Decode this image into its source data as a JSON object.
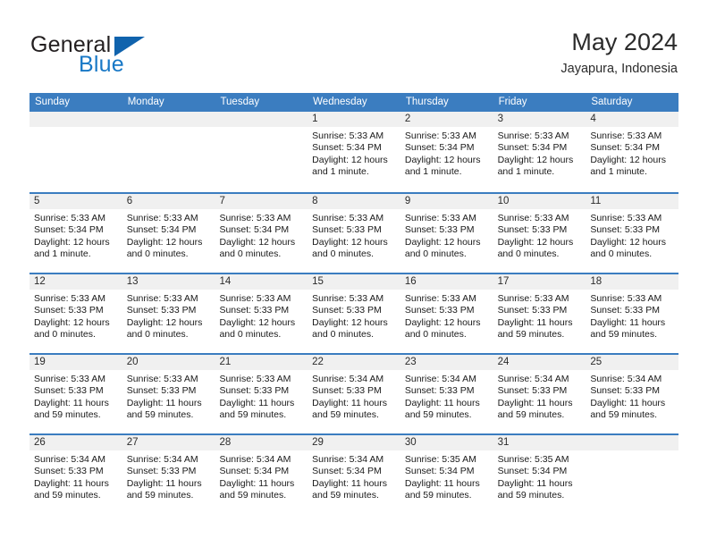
{
  "brand": {
    "name_top": "General",
    "name_bottom": "Blue",
    "accent_color": "#1878c6",
    "triangle_color": "#1063ad"
  },
  "header": {
    "title": "May 2024",
    "subtitle": "Jayapura, Indonesia"
  },
  "theme": {
    "header_row_bg": "#3b7dc0",
    "day_band_bg": "#f0f0f0",
    "week_separator": "#3b7dc0"
  },
  "weekdays": [
    "Sunday",
    "Monday",
    "Tuesday",
    "Wednesday",
    "Thursday",
    "Friday",
    "Saturday"
  ],
  "weeks": [
    [
      {
        "day": "",
        "empty": true
      },
      {
        "day": "",
        "empty": true
      },
      {
        "day": "",
        "empty": true
      },
      {
        "day": "1",
        "sunrise": "Sunrise: 5:33 AM",
        "sunset": "Sunset: 5:34 PM",
        "daylight_1": "Daylight: 12 hours",
        "daylight_2": "and 1 minute."
      },
      {
        "day": "2",
        "sunrise": "Sunrise: 5:33 AM",
        "sunset": "Sunset: 5:34 PM",
        "daylight_1": "Daylight: 12 hours",
        "daylight_2": "and 1 minute."
      },
      {
        "day": "3",
        "sunrise": "Sunrise: 5:33 AM",
        "sunset": "Sunset: 5:34 PM",
        "daylight_1": "Daylight: 12 hours",
        "daylight_2": "and 1 minute."
      },
      {
        "day": "4",
        "sunrise": "Sunrise: 5:33 AM",
        "sunset": "Sunset: 5:34 PM",
        "daylight_1": "Daylight: 12 hours",
        "daylight_2": "and 1 minute."
      }
    ],
    [
      {
        "day": "5",
        "sunrise": "Sunrise: 5:33 AM",
        "sunset": "Sunset: 5:34 PM",
        "daylight_1": "Daylight: 12 hours",
        "daylight_2": "and 1 minute."
      },
      {
        "day": "6",
        "sunrise": "Sunrise: 5:33 AM",
        "sunset": "Sunset: 5:34 PM",
        "daylight_1": "Daylight: 12 hours",
        "daylight_2": "and 0 minutes."
      },
      {
        "day": "7",
        "sunrise": "Sunrise: 5:33 AM",
        "sunset": "Sunset: 5:34 PM",
        "daylight_1": "Daylight: 12 hours",
        "daylight_2": "and 0 minutes."
      },
      {
        "day": "8",
        "sunrise": "Sunrise: 5:33 AM",
        "sunset": "Sunset: 5:33 PM",
        "daylight_1": "Daylight: 12 hours",
        "daylight_2": "and 0 minutes."
      },
      {
        "day": "9",
        "sunrise": "Sunrise: 5:33 AM",
        "sunset": "Sunset: 5:33 PM",
        "daylight_1": "Daylight: 12 hours",
        "daylight_2": "and 0 minutes."
      },
      {
        "day": "10",
        "sunrise": "Sunrise: 5:33 AM",
        "sunset": "Sunset: 5:33 PM",
        "daylight_1": "Daylight: 12 hours",
        "daylight_2": "and 0 minutes."
      },
      {
        "day": "11",
        "sunrise": "Sunrise: 5:33 AM",
        "sunset": "Sunset: 5:33 PM",
        "daylight_1": "Daylight: 12 hours",
        "daylight_2": "and 0 minutes."
      }
    ],
    [
      {
        "day": "12",
        "sunrise": "Sunrise: 5:33 AM",
        "sunset": "Sunset: 5:33 PM",
        "daylight_1": "Daylight: 12 hours",
        "daylight_2": "and 0 minutes."
      },
      {
        "day": "13",
        "sunrise": "Sunrise: 5:33 AM",
        "sunset": "Sunset: 5:33 PM",
        "daylight_1": "Daylight: 12 hours",
        "daylight_2": "and 0 minutes."
      },
      {
        "day": "14",
        "sunrise": "Sunrise: 5:33 AM",
        "sunset": "Sunset: 5:33 PM",
        "daylight_1": "Daylight: 12 hours",
        "daylight_2": "and 0 minutes."
      },
      {
        "day": "15",
        "sunrise": "Sunrise: 5:33 AM",
        "sunset": "Sunset: 5:33 PM",
        "daylight_1": "Daylight: 12 hours",
        "daylight_2": "and 0 minutes."
      },
      {
        "day": "16",
        "sunrise": "Sunrise: 5:33 AM",
        "sunset": "Sunset: 5:33 PM",
        "daylight_1": "Daylight: 12 hours",
        "daylight_2": "and 0 minutes."
      },
      {
        "day": "17",
        "sunrise": "Sunrise: 5:33 AM",
        "sunset": "Sunset: 5:33 PM",
        "daylight_1": "Daylight: 11 hours",
        "daylight_2": "and 59 minutes."
      },
      {
        "day": "18",
        "sunrise": "Sunrise: 5:33 AM",
        "sunset": "Sunset: 5:33 PM",
        "daylight_1": "Daylight: 11 hours",
        "daylight_2": "and 59 minutes."
      }
    ],
    [
      {
        "day": "19",
        "sunrise": "Sunrise: 5:33 AM",
        "sunset": "Sunset: 5:33 PM",
        "daylight_1": "Daylight: 11 hours",
        "daylight_2": "and 59 minutes."
      },
      {
        "day": "20",
        "sunrise": "Sunrise: 5:33 AM",
        "sunset": "Sunset: 5:33 PM",
        "daylight_1": "Daylight: 11 hours",
        "daylight_2": "and 59 minutes."
      },
      {
        "day": "21",
        "sunrise": "Sunrise: 5:33 AM",
        "sunset": "Sunset: 5:33 PM",
        "daylight_1": "Daylight: 11 hours",
        "daylight_2": "and 59 minutes."
      },
      {
        "day": "22",
        "sunrise": "Sunrise: 5:34 AM",
        "sunset": "Sunset: 5:33 PM",
        "daylight_1": "Daylight: 11 hours",
        "daylight_2": "and 59 minutes."
      },
      {
        "day": "23",
        "sunrise": "Sunrise: 5:34 AM",
        "sunset": "Sunset: 5:33 PM",
        "daylight_1": "Daylight: 11 hours",
        "daylight_2": "and 59 minutes."
      },
      {
        "day": "24",
        "sunrise": "Sunrise: 5:34 AM",
        "sunset": "Sunset: 5:33 PM",
        "daylight_1": "Daylight: 11 hours",
        "daylight_2": "and 59 minutes."
      },
      {
        "day": "25",
        "sunrise": "Sunrise: 5:34 AM",
        "sunset": "Sunset: 5:33 PM",
        "daylight_1": "Daylight: 11 hours",
        "daylight_2": "and 59 minutes."
      }
    ],
    [
      {
        "day": "26",
        "sunrise": "Sunrise: 5:34 AM",
        "sunset": "Sunset: 5:33 PM",
        "daylight_1": "Daylight: 11 hours",
        "daylight_2": "and 59 minutes."
      },
      {
        "day": "27",
        "sunrise": "Sunrise: 5:34 AM",
        "sunset": "Sunset: 5:33 PM",
        "daylight_1": "Daylight: 11 hours",
        "daylight_2": "and 59 minutes."
      },
      {
        "day": "28",
        "sunrise": "Sunrise: 5:34 AM",
        "sunset": "Sunset: 5:34 PM",
        "daylight_1": "Daylight: 11 hours",
        "daylight_2": "and 59 minutes."
      },
      {
        "day": "29",
        "sunrise": "Sunrise: 5:34 AM",
        "sunset": "Sunset: 5:34 PM",
        "daylight_1": "Daylight: 11 hours",
        "daylight_2": "and 59 minutes."
      },
      {
        "day": "30",
        "sunrise": "Sunrise: 5:35 AM",
        "sunset": "Sunset: 5:34 PM",
        "daylight_1": "Daylight: 11 hours",
        "daylight_2": "and 59 minutes."
      },
      {
        "day": "31",
        "sunrise": "Sunrise: 5:35 AM",
        "sunset": "Sunset: 5:34 PM",
        "daylight_1": "Daylight: 11 hours",
        "daylight_2": "and 59 minutes."
      },
      {
        "day": "",
        "empty": true
      }
    ]
  ]
}
